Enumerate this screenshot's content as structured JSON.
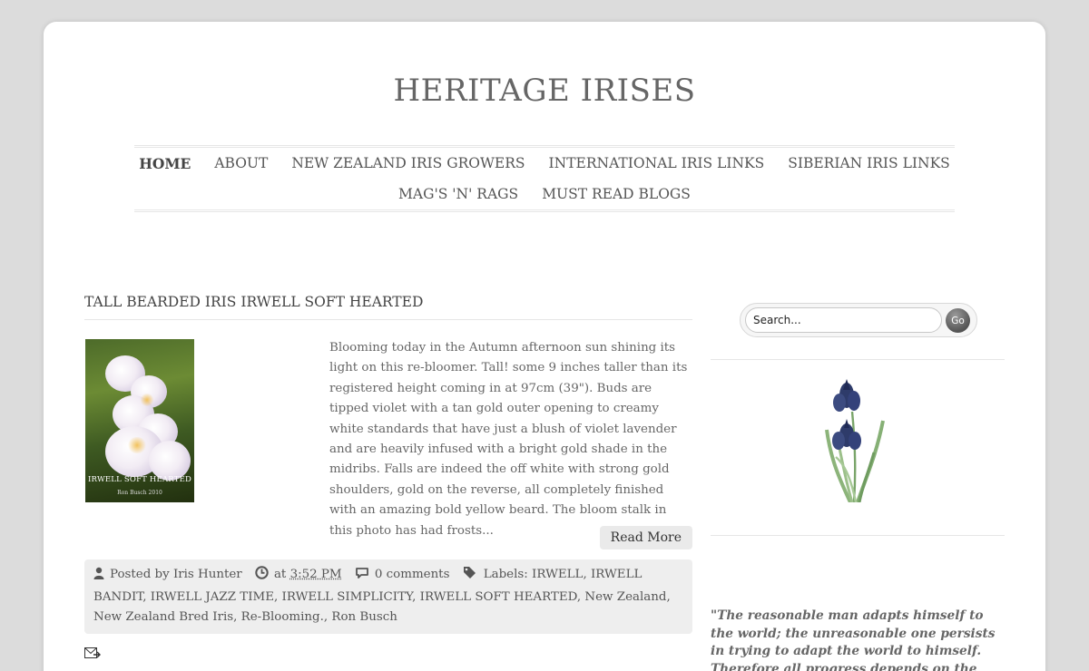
{
  "site": {
    "title": "HERITAGE IRISES"
  },
  "nav": {
    "row1": [
      "HOME",
      "ABOUT",
      "NEW ZEALAND IRIS GROWERS",
      "INTERNATIONAL IRIS LINKS",
      "SIBERIAN IRIS LINKS"
    ],
    "row2": [
      "MAG'S 'N' RAGS",
      "MUST READ BLOGS"
    ],
    "active": "HOME"
  },
  "post": {
    "title": "TALL BEARDED IRIS IRWELL SOFT HEARTED",
    "image_caption": "IRWELL SOFT HEARTED",
    "image_caption_sub": "Ron Busch 2010",
    "excerpt": "Blooming today in the Autumn afternoon sun shining its light on this re-bloomer. Tall! some 9 inches taller than its registered height coming in at 97cm (39\"). Buds are tipped violet with a tan gold outer opening to creamy white standards that have just a blush of violet lavender and are heavily infused with a bright gold shade in the midribs. Falls are indeed the off white with strong gold shoulders, gold on the reverse, all completely finished with an amazing bold yellow beard. The bloom stalk in this photo has had frosts...",
    "read_more": "Read More",
    "meta": {
      "posted_by_label": "Posted by",
      "author": "Iris Hunter",
      "at_label": "at",
      "time": "3:52 PM",
      "comments": "0 comments",
      "labels_label": "Labels:",
      "labels": [
        "IRWELL",
        "IRWELL BANDIT",
        "IRWELL JAZZ TIME",
        "IRWELL SIMPLICITY",
        "IRWELL SOFT HEARTED",
        "New Zealand",
        "New Zealand Bred Iris",
        "Re-Blooming.",
        "Ron Busch"
      ]
    }
  },
  "sidebar": {
    "search_placeholder": "Search...",
    "search_button": "Go",
    "quote": "\"The reasonable man adapts himself to the world; the unreasonable one persists in trying to adapt the world to himself. Therefore all progress depends on the unreasonable man\"."
  },
  "colors": {
    "background": "#dcdcdc",
    "page": "#ffffff",
    "text": "#555555",
    "meta_bg": "#eeeeee"
  },
  "icons": [
    "person-icon",
    "clock-icon",
    "comment-icon",
    "tag-icon",
    "email-icon",
    "search-go-button"
  ]
}
